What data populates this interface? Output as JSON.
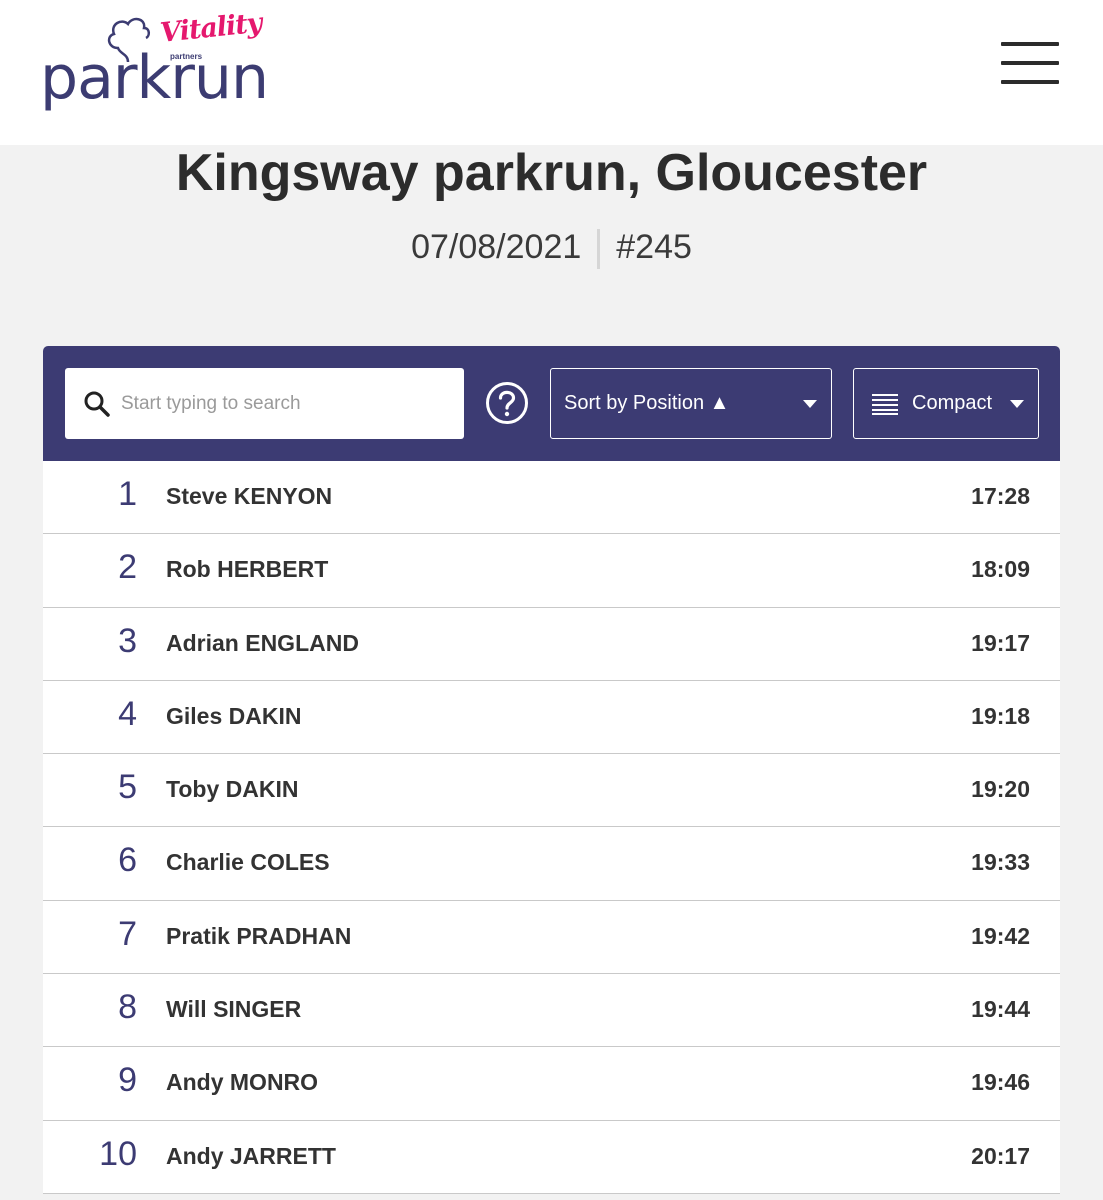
{
  "header": {
    "logo": {
      "brand": "parkrun",
      "sponsor": "Vitality",
      "sponsor_sub": "partners"
    },
    "menu_icon": "hamburger-icon"
  },
  "event": {
    "title": "Kingsway parkrun, Gloucester",
    "date": "07/08/2021",
    "run_number": "#245"
  },
  "toolbar": {
    "search_placeholder": "Start typing to search",
    "help_icon": "question-circle-icon",
    "sort_label": "Sort by Position ▲",
    "view_label": "Compact"
  },
  "colors": {
    "toolbar_bg": "#3c3b73",
    "brand_pink": "#e5186e",
    "brand_purple": "#3c3c72"
  },
  "results": [
    {
      "position": "1",
      "name": "Steve KENYON",
      "time": "17:28"
    },
    {
      "position": "2",
      "name": "Rob HERBERT",
      "time": "18:09"
    },
    {
      "position": "3",
      "name": "Adrian ENGLAND",
      "time": "19:17"
    },
    {
      "position": "4",
      "name": "Giles DAKIN",
      "time": "19:18"
    },
    {
      "position": "5",
      "name": "Toby DAKIN",
      "time": "19:20"
    },
    {
      "position": "6",
      "name": "Charlie COLES",
      "time": "19:33"
    },
    {
      "position": "7",
      "name": "Pratik PRADHAN",
      "time": "19:42"
    },
    {
      "position": "8",
      "name": "Will SINGER",
      "time": "19:44"
    },
    {
      "position": "9",
      "name": "Andy MONRO",
      "time": "19:46"
    },
    {
      "position": "10",
      "name": "Andy JARRETT",
      "time": "20:17"
    }
  ]
}
